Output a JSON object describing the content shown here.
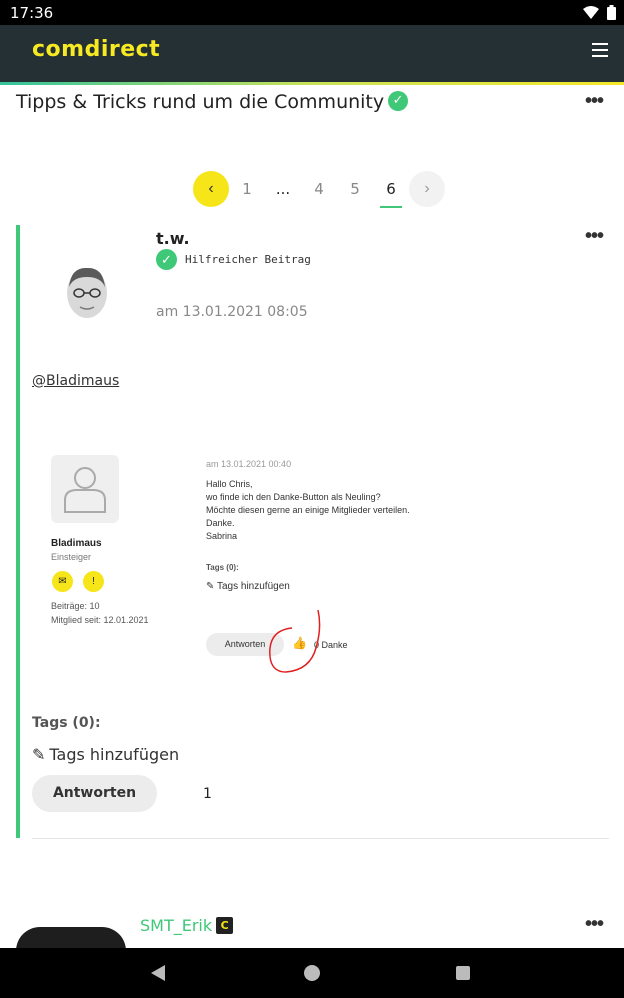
{
  "status_bar": {
    "time": "17:36"
  },
  "header": {
    "logo": "comdirect"
  },
  "topic": {
    "title": "Tipps & Tricks rund um die Community",
    "menu": "•••"
  },
  "pagination": {
    "prev": "‹",
    "next": "›",
    "pages": [
      "1",
      "...",
      "4",
      "5",
      "6"
    ],
    "active": "6"
  },
  "post": {
    "author": "t.w.",
    "badge": "Hilfreicher Beitrag",
    "date": "am 13.01.2021 08:05",
    "mention": "@Bladimaus",
    "menu": "•••",
    "embedded": {
      "user": "Bladimaus",
      "rank": "Einsteiger",
      "posts": "Beiträge: 10",
      "member_since": "Mitglied seit: 12.01.2021",
      "date": "am 13.01.2021 00:40",
      "body": [
        "Hallo Chris,",
        "wo finde ich den Danke-Button als Neuling?",
        "Möchte diesen gerne an einige Mitglieder verteilen.",
        "Danke.",
        "Sabrina"
      ],
      "tags": "Tags (0):",
      "add_tags": "Tags hinzufügen",
      "reply": "Antworten",
      "thanks": "0 Danke"
    },
    "tags": "Tags (0):",
    "add_tags": "Tags hinzufügen",
    "reply": "Antworten",
    "kudos": "1"
  },
  "next_post": {
    "author": "SMT_Erik",
    "badge": "C",
    "menu": "•••"
  },
  "colors": {
    "brand_yellow": "#f6e518",
    "header_bg": "#243034",
    "accent_green": "#3ec878"
  }
}
